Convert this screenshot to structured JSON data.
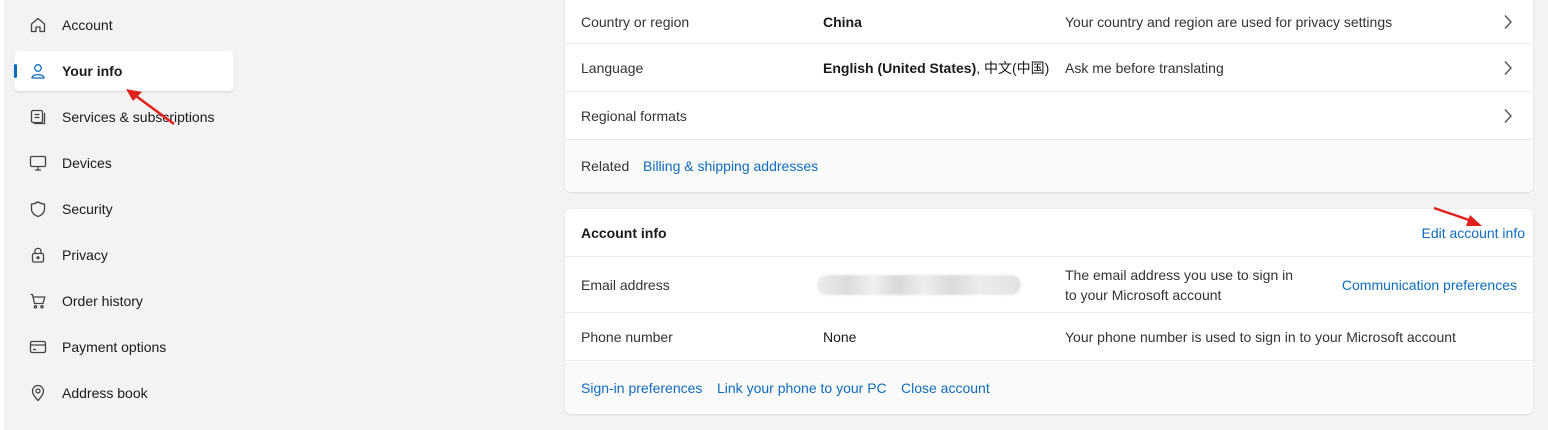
{
  "sidebar": {
    "items": [
      {
        "label": "Account",
        "icon": "home-icon"
      },
      {
        "label": "Your info",
        "icon": "person-icon",
        "selected": true
      },
      {
        "label": "Services & subscriptions",
        "icon": "subscriptions-icon"
      },
      {
        "label": "Devices",
        "icon": "monitor-icon"
      },
      {
        "label": "Security",
        "icon": "shield-icon"
      },
      {
        "label": "Privacy",
        "icon": "lock-icon"
      },
      {
        "label": "Order history",
        "icon": "cart-icon"
      },
      {
        "label": "Payment options",
        "icon": "credit-card-icon"
      },
      {
        "label": "Address book",
        "icon": "location-pin-icon"
      }
    ]
  },
  "region_card": {
    "rows": [
      {
        "label": "Country or region",
        "value": "China",
        "description": "Your country and region are used for privacy settings"
      },
      {
        "label": "Language",
        "value_bold": "English (United States)",
        "value_rest": ", 中文(中国)",
        "description": "Ask me before translating"
      },
      {
        "label": "Regional formats"
      }
    ],
    "related_label": "Related",
    "related_link": "Billing & shipping addresses"
  },
  "account_card": {
    "title": "Account info",
    "edit_link": "Edit account info",
    "email": {
      "label": "Email address",
      "description": "The email address you use to sign in to your Microsoft account",
      "link": "Communication preferences"
    },
    "phone": {
      "label": "Phone number",
      "value": "None",
      "description": "Your phone number is used to sign in to your Microsoft account"
    },
    "footer_links": [
      "Sign-in preferences",
      "Link your phone to your PC",
      "Close account"
    ]
  },
  "colors": {
    "accent": "#0f6cbd",
    "annotation_arrow": "#e0201b",
    "background": "#f3f3f3"
  }
}
